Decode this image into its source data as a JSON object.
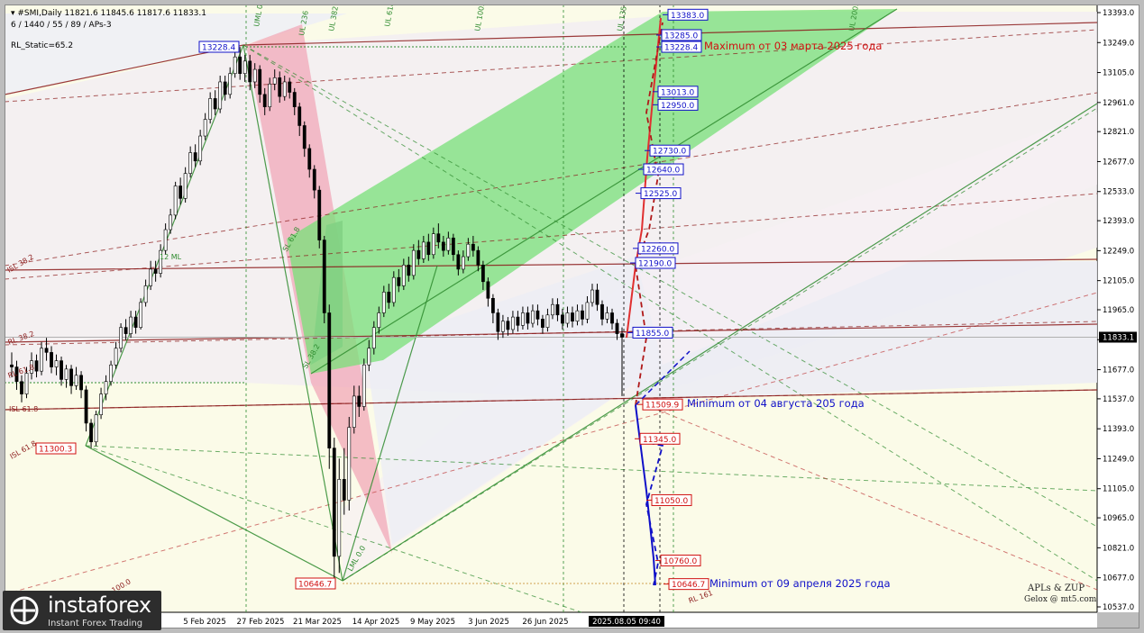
{
  "header": {
    "symbol_line": "▾ #SMI,Daily  11821.6 11845.6 11817.6 11833.1",
    "params_line": "6 / 1440 / 55 / 89 / APs-3",
    "static_label": "RL_Static=65.2"
  },
  "logo": {
    "name": "instaforex",
    "tagline": "Instant Forex Trading"
  },
  "credits": {
    "line1": "APLs & ZUP",
    "line2": "Gelox @ mt5.com"
  },
  "chart_data": {
    "type": "candlestick",
    "title": "",
    "ylim": [
      10500,
      13420
    ],
    "current_price": "11833.1",
    "y_ticks": [
      13393.0,
      13249.0,
      13105.0,
      12961.0,
      12821.0,
      12677.0,
      12533.0,
      12393.0,
      12249.0,
      12105.0,
      11965.0,
      11821.0,
      11677.0,
      11537.0,
      11393.0,
      11249.0,
      11105.0,
      10965.0,
      10821.0,
      10677.0,
      10537.0
    ],
    "x_ticks": [
      "5 Feb 2025",
      "27 Feb 2025",
      "21 Mar 2025",
      "14 Apr 2025",
      "9 May 2025",
      "3 Jun 2025",
      "26 Jun 2025",
      "2025.08.05 09:40"
    ],
    "level_labels": [
      {
        "text": "13383.0",
        "color": "#1010c8",
        "price": 13383.0
      },
      {
        "text": "13285.0",
        "color": "#1010c8",
        "price": 13285.0
      },
      {
        "text": "13228.4",
        "color": "#1010c8",
        "price": 13228.4
      },
      {
        "text": "13013.0",
        "color": "#1010c8",
        "price": 13013.0
      },
      {
        "text": "12950.0",
        "color": "#1010c8",
        "price": 12950.0
      },
      {
        "text": "12730.0",
        "color": "#1010c8",
        "price": 12730.0
      },
      {
        "text": "12640.0",
        "color": "#1010c8",
        "price": 12640.0
      },
      {
        "text": "12525.0",
        "color": "#1010c8",
        "price": 12525.0
      },
      {
        "text": "12260.0",
        "color": "#1010c8",
        "price": 12260.0
      },
      {
        "text": "12190.0",
        "color": "#1010c8",
        "price": 12190.0
      },
      {
        "text": "11855.0",
        "color": "#1010c8",
        "price": 11855.0
      },
      {
        "text": "11509.9",
        "color": "#d01010",
        "price": 11509.9
      },
      {
        "text": "11345.0",
        "color": "#d01010",
        "price": 11345.0
      },
      {
        "text": "11050.0",
        "color": "#d01010",
        "price": 11050.0
      },
      {
        "text": "10760.0",
        "color": "#d01010",
        "price": 10760.0
      },
      {
        "text": "10646.7",
        "color": "#d01010",
        "price": 10646.7
      }
    ],
    "pivot_labels": [
      {
        "text": "13228.4",
        "color": "#1010c8",
        "price": 13228.4
      },
      {
        "text": "11300.3",
        "color": "#d01010",
        "price": 11300.3
      },
      {
        "text": "10646.7",
        "color": "#d01010",
        "price": 10646.7
      }
    ],
    "annotations": [
      {
        "text": "Maximum от 03 марта 2025 года",
        "color": "#d01010"
      },
      {
        "text": "Minimum от 04 августа 205 года",
        "color": "#1010c8"
      },
      {
        "text": "Minimum от 09 апреля 2025 года",
        "color": "#1010c8"
      }
    ],
    "fib_labels": [
      "UML 0.0",
      "UL 236",
      "UL 382",
      "UL 618",
      "UL 100.0",
      "UL 135",
      "UL 200.0",
      "SL 61.8",
      "SL 38.2",
      "12 ML",
      "ISL 38.2",
      "ISL 61.8",
      "ISL 61.8",
      "RL 38.2",
      "RL 61.8",
      "RL 100.0",
      "LML 0.0",
      "RL 161"
    ],
    "candles": [
      [
        11700,
        11690,
        11760,
        11640
      ],
      [
        11690,
        11620,
        11720,
        11580
      ],
      [
        11620,
        11560,
        11650,
        11520
      ],
      [
        11560,
        11660,
        11690,
        11540
      ],
      [
        11660,
        11720,
        11760,
        11630
      ],
      [
        11720,
        11670,
        11750,
        11640
      ],
      [
        11670,
        11780,
        11810,
        11650
      ],
      [
        11780,
        11760,
        11830,
        11720
      ],
      [
        11760,
        11690,
        11790,
        11660
      ],
      [
        11690,
        11720,
        11750,
        11650
      ],
      [
        11720,
        11630,
        11740,
        11600
      ],
      [
        11630,
        11680,
        11700,
        11590
      ],
      [
        11680,
        11600,
        11700,
        11560
      ],
      [
        11600,
        11650,
        11690,
        11580
      ],
      [
        11650,
        11580,
        11670,
        11540
      ],
      [
        11580,
        11420,
        11600,
        11380
      ],
      [
        11420,
        11330,
        11440,
        11300
      ],
      [
        11330,
        11460,
        11480,
        11310
      ],
      [
        11460,
        11560,
        11590,
        11440
      ],
      [
        11560,
        11620,
        11650,
        11530
      ],
      [
        11620,
        11700,
        11720,
        11600
      ],
      [
        11700,
        11780,
        11810,
        11680
      ],
      [
        11780,
        11880,
        11900,
        11760
      ],
      [
        11880,
        11850,
        11920,
        11820
      ],
      [
        11850,
        11930,
        11960,
        11830
      ],
      [
        11930,
        11880,
        11960,
        11850
      ],
      [
        11880,
        12000,
        12020,
        11870
      ],
      [
        12000,
        12080,
        12110,
        11980
      ],
      [
        12080,
        12160,
        12200,
        12060
      ],
      [
        12160,
        12140,
        12200,
        12100
      ],
      [
        12140,
        12250,
        12280,
        12120
      ],
      [
        12250,
        12350,
        12380,
        12230
      ],
      [
        12350,
        12420,
        12450,
        12330
      ],
      [
        12420,
        12560,
        12580,
        12400
      ],
      [
        12560,
        12500,
        12600,
        12470
      ],
      [
        12500,
        12620,
        12650,
        12480
      ],
      [
        12620,
        12720,
        12750,
        12600
      ],
      [
        12720,
        12680,
        12760,
        12650
      ],
      [
        12680,
        12800,
        12830,
        12660
      ],
      [
        12800,
        12880,
        12910,
        12780
      ],
      [
        12880,
        12980,
        13010,
        12860
      ],
      [
        12980,
        12930,
        13020,
        12900
      ],
      [
        12930,
        13060,
        13090,
        12910
      ],
      [
        13060,
        13000,
        13090,
        12970
      ],
      [
        13000,
        13100,
        13130,
        12980
      ],
      [
        13100,
        13180,
        13210,
        13080
      ],
      [
        13180,
        13100,
        13228,
        13070
      ],
      [
        13100,
        13160,
        13190,
        13060
      ],
      [
        13160,
        13060,
        13190,
        13020
      ],
      [
        13060,
        13120,
        13150,
        13030
      ],
      [
        13120,
        13000,
        13140,
        12960
      ],
      [
        13000,
        12940,
        13030,
        12900
      ],
      [
        12940,
        13050,
        13080,
        12920
      ],
      [
        13050,
        13080,
        13120,
        13020
      ],
      [
        13080,
        12990,
        13110,
        12960
      ],
      [
        12990,
        13060,
        13090,
        12970
      ],
      [
        13060,
        13010,
        13080,
        12980
      ],
      [
        13010,
        12940,
        13030,
        12900
      ],
      [
        12940,
        12850,
        12960,
        12800
      ],
      [
        12850,
        12740,
        12870,
        12700
      ],
      [
        12740,
        12640,
        12760,
        12600
      ],
      [
        12640,
        12540,
        12660,
        12500
      ],
      [
        12540,
        12300,
        12560,
        12260
      ],
      [
        12300,
        11950,
        12320,
        11900
      ],
      [
        11950,
        11300,
        11990,
        11200
      ],
      [
        11300,
        10780,
        11350,
        10646.7
      ],
      [
        10780,
        11150,
        11250,
        10700
      ],
      [
        11150,
        11050,
        11300,
        10980
      ],
      [
        11050,
        11400,
        11450,
        11000
      ],
      [
        11400,
        11550,
        11600,
        11370
      ],
      [
        11550,
        11500,
        11600,
        11450
      ],
      [
        11500,
        11700,
        11730,
        11480
      ],
      [
        11700,
        11780,
        11820,
        11670
      ],
      [
        11780,
        11880,
        11910,
        11750
      ],
      [
        11880,
        11950,
        11980,
        11850
      ],
      [
        11950,
        12050,
        12080,
        11930
      ],
      [
        12050,
        12000,
        12090,
        11970
      ],
      [
        12000,
        12120,
        12150,
        11980
      ],
      [
        12120,
        12080,
        12160,
        12050
      ],
      [
        12080,
        12180,
        12210,
        12060
      ],
      [
        12180,
        12130,
        12220,
        12100
      ],
      [
        12130,
        12250,
        12280,
        12110
      ],
      [
        12250,
        12210,
        12300,
        12180
      ],
      [
        12210,
        12290,
        12320,
        12190
      ],
      [
        12290,
        12230,
        12330,
        12200
      ],
      [
        12230,
        12330,
        12360,
        12210
      ],
      [
        12330,
        12290,
        12380,
        12260
      ],
      [
        12290,
        12250,
        12320,
        12220
      ],
      [
        12250,
        12310,
        12340,
        12230
      ],
      [
        12310,
        12230,
        12330,
        12200
      ],
      [
        12230,
        12160,
        12250,
        12130
      ],
      [
        12160,
        12220,
        12250,
        12140
      ],
      [
        12220,
        12280,
        12310,
        12200
      ],
      [
        12280,
        12250,
        12320,
        12220
      ],
      [
        12250,
        12180,
        12270,
        12150
      ],
      [
        12180,
        12100,
        12200,
        12060
      ],
      [
        12100,
        12020,
        12120,
        11980
      ],
      [
        12020,
        11950,
        12040,
        11900
      ],
      [
        11950,
        11860,
        11970,
        11820
      ],
      [
        11860,
        11910,
        11940,
        11830
      ],
      [
        11910,
        11870,
        11930,
        11840
      ],
      [
        11870,
        11930,
        11960,
        11850
      ],
      [
        11930,
        11890,
        11960,
        11860
      ],
      [
        11890,
        11950,
        11980,
        11870
      ],
      [
        11950,
        11900,
        11980,
        11870
      ],
      [
        11900,
        11960,
        11990,
        11880
      ],
      [
        11960,
        11920,
        11990,
        11890
      ],
      [
        11920,
        11880,
        11940,
        11850
      ],
      [
        11880,
        11940,
        11970,
        11860
      ],
      [
        11940,
        11990,
        12020,
        11920
      ],
      [
        11990,
        11940,
        12020,
        11910
      ],
      [
        11940,
        11900,
        11970,
        11870
      ],
      [
        11900,
        11950,
        11980,
        11880
      ],
      [
        11950,
        11910,
        11980,
        11880
      ],
      [
        11910,
        11960,
        11990,
        11890
      ],
      [
        11960,
        11920,
        11990,
        11890
      ],
      [
        11920,
        12000,
        12030,
        11900
      ],
      [
        12000,
        12060,
        12090,
        11980
      ],
      [
        12060,
        11990,
        12090,
        11960
      ],
      [
        11990,
        11920,
        12010,
        11890
      ],
      [
        11920,
        11950,
        11980,
        11900
      ],
      [
        11950,
        11900,
        11970,
        11870
      ],
      [
        11900,
        11850,
        11920,
        11820
      ],
      [
        11850,
        11833.1,
        11880,
        11550
      ]
    ]
  }
}
